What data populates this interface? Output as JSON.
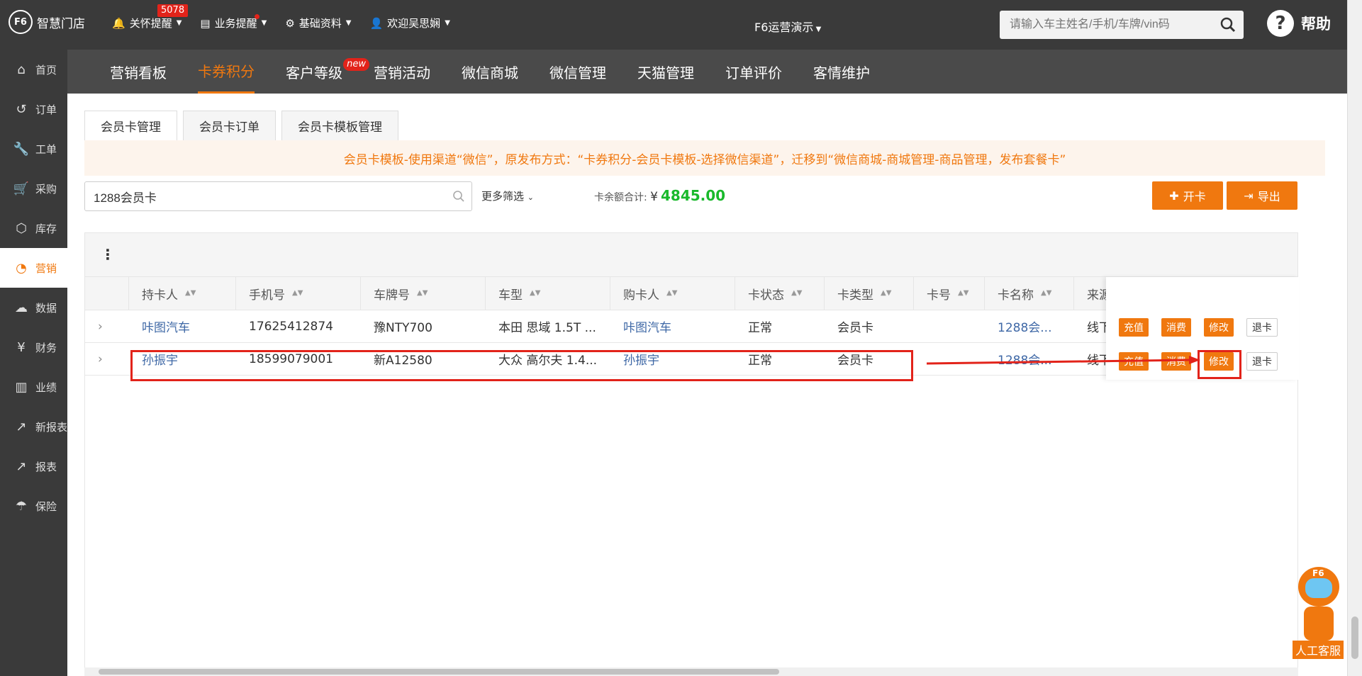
{
  "app": {
    "logo_text": "智慧门店",
    "logo_mark": "F6"
  },
  "topnav": {
    "care": {
      "label": "关怀提醒",
      "badge": "5078"
    },
    "business": {
      "label": "业务提醒"
    },
    "basic": {
      "label": "基础资料"
    },
    "welcome": {
      "label": "欢迎吴思娴"
    }
  },
  "store": {
    "label": "F6运营演示"
  },
  "search": {
    "placeholder": "请输入车主姓名/手机/车牌/vin码"
  },
  "help": {
    "label": "帮助"
  },
  "sidebar": {
    "items": [
      {
        "label": "首页",
        "icon": "home-icon"
      },
      {
        "label": "订单",
        "icon": "history-icon"
      },
      {
        "label": "工单",
        "icon": "wrench-icon"
      },
      {
        "label": "采购",
        "icon": "cart-icon"
      },
      {
        "label": "库存",
        "icon": "box-icon"
      },
      {
        "label": "营销",
        "icon": "pie-icon"
      },
      {
        "label": "数据",
        "icon": "cloud-icon"
      },
      {
        "label": "财务",
        "icon": "yen-icon"
      },
      {
        "label": "业绩",
        "icon": "bar-icon"
      },
      {
        "label": "新报表",
        "icon": "line-chart-icon"
      },
      {
        "label": "报表",
        "icon": "trend-icon"
      },
      {
        "label": "保险",
        "icon": "umbrella-icon"
      }
    ]
  },
  "subnav": {
    "tabs": [
      "营销看板",
      "卡券积分",
      "客户等级",
      "营销活动",
      "微信商城",
      "微信管理",
      "天猫管理",
      "订单评价",
      "客情维护"
    ],
    "new_badge": "new"
  },
  "cardtabs": [
    "会员卡管理",
    "会员卡订单",
    "会员卡模板管理"
  ],
  "notice": "会员卡模板-使用渠道“微信”，原发布方式：“卡券积分-会员卡模板-选择微信渠道”，迁移到“微信商城-商城管理-商品管理，发布套餐卡”",
  "filter": {
    "value": "1288会员卡",
    "more": "更多筛选"
  },
  "balance": {
    "label": "卡余额合计:",
    "currency": "¥",
    "amount": "4845.00"
  },
  "actions": {
    "open": "开卡",
    "export": "导出"
  },
  "table": {
    "columns": [
      "持卡人",
      "手机号",
      "车牌号",
      "车型",
      "购卡人",
      "卡状态",
      "卡类型",
      "卡号",
      "卡名称",
      "来源"
    ],
    "rows": [
      {
        "holder": "咔图汽车",
        "phone": "17625412874",
        "plate": "豫NTY700",
        "model": "本田 思域 1.5T ...",
        "buyer": "咔图汽车",
        "status": "正常",
        "type": "会员卡",
        "no": "",
        "name": "1288会...",
        "source": "线下"
      },
      {
        "holder": "孙振宇",
        "phone": "18599079001",
        "plate": "新A12580",
        "model": "大众 高尔夫 1.4...",
        "buyer": "孙振宇",
        "status": "正常",
        "type": "会员卡",
        "no": "",
        "name": "1288会...",
        "source": "线下"
      }
    ],
    "ops": {
      "recharge": "充值",
      "consume": "消费",
      "edit": "修改",
      "refund": "退卡"
    }
  },
  "robot": {
    "label": "人工客服",
    "mark": "F6"
  },
  "colors": {
    "accent": "#f0780f",
    "dark": "#3a3a3a",
    "highlight": "#e2231a",
    "link": "#3f68a6",
    "money": "#19b92b"
  }
}
